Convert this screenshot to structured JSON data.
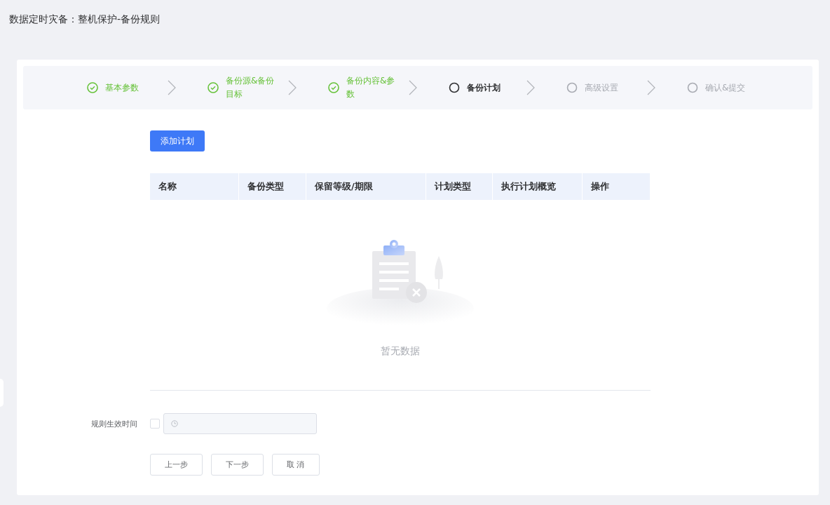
{
  "page_title": "数据定时灾备：整机保护-备份规则",
  "steps": [
    {
      "label": "基本参数",
      "completed": true,
      "selected": false
    },
    {
      "label": "备份源&备份目标",
      "completed": true,
      "selected": false
    },
    {
      "label": "备份内容&参数",
      "completed": true,
      "selected": false
    },
    {
      "label": "备份计划",
      "completed": false,
      "selected": true
    },
    {
      "label": "高级设置",
      "completed": false,
      "selected": false
    },
    {
      "label": "确认&提交",
      "completed": false,
      "selected": false
    }
  ],
  "add_button": "添加计划",
  "table": {
    "columns": [
      "名称",
      "备份类型",
      "保留等级/期限",
      "计划类型",
      "执行计划概览",
      "操作"
    ],
    "empty_text": "暂无数据"
  },
  "rule_time": {
    "label": "规则生效时间",
    "checked": false,
    "disabled": true
  },
  "buttons": [
    "上一步",
    "下一步",
    "取 消"
  ]
}
